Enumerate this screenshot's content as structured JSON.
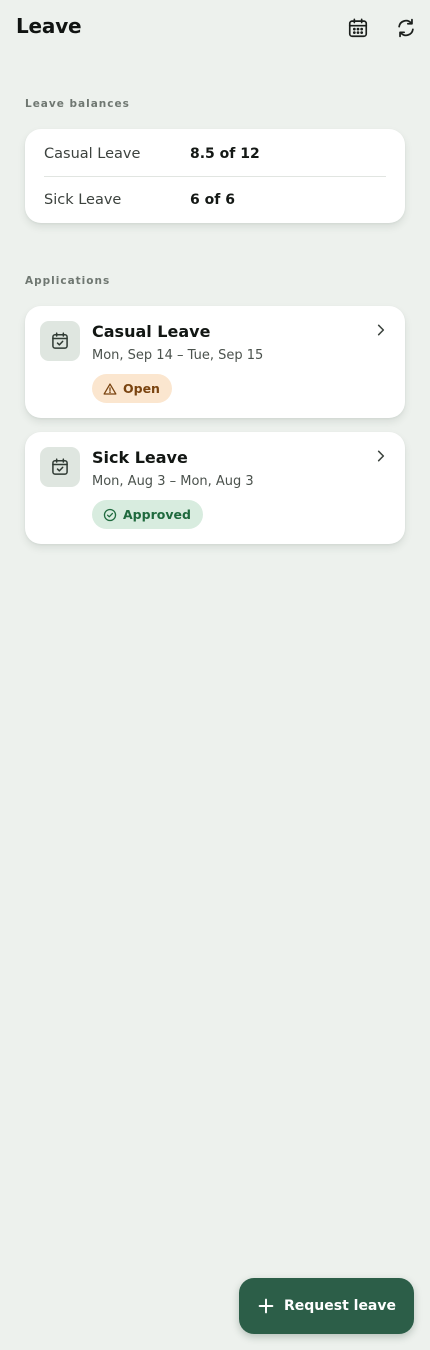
{
  "header": {
    "title": "Leave",
    "calendar_icon": "calendar-icon",
    "refresh_icon": "refresh-icon"
  },
  "balances": {
    "section_label": "Leave balances",
    "items": [
      {
        "name": "Casual Leave",
        "value": "8.5 of 12"
      },
      {
        "name": "Sick Leave",
        "value": "6 of 6"
      }
    ]
  },
  "applications": {
    "section_label": "Applications",
    "items": [
      {
        "type": "Casual Leave",
        "dates": "Mon, Sep 14 – Tue, Sep 15",
        "status": "Open",
        "status_icon": "warning-icon"
      },
      {
        "type": "Sick Leave",
        "dates": "Mon, Aug 3 – Mon, Aug 3",
        "status": "Approved",
        "status_icon": "check-circle-icon"
      }
    ]
  },
  "fab": {
    "label": "Request leave",
    "icon": "plus-icon"
  },
  "colors": {
    "background": "#edf1ed",
    "accent": "#2c5e48",
    "open_badge_bg": "#fbe6cf",
    "open_badge_text": "#7a4410",
    "approved_badge_bg": "#d8ecdf",
    "approved_badge_text": "#1f6a3e"
  }
}
